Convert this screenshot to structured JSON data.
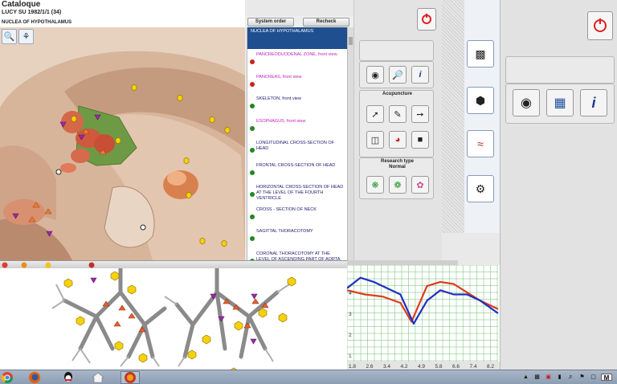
{
  "header": {
    "title": "Cataloque",
    "patient": "LUCY SU   1982/1/1 (34)",
    "section": "NUCLEA OF HYPOTHALAMUS"
  },
  "tabs": {
    "system_order": "System order",
    "recheck": "Recheck"
  },
  "list": {
    "selected": "NUCLEA OF HYPOTHALAMUS",
    "items": [
      {
        "label": "PANCREODUODENAL ZONE, front view",
        "color": "#c020c0",
        "dot": "#cc2222"
      },
      {
        "label": "PANCREAS, front view",
        "color": "#c020c0",
        "dot": "#cc2222"
      },
      {
        "label": "SKELETON, front view",
        "color": "#1a1a6e",
        "dot": "#228822"
      },
      {
        "label": "ESOPHAGUS, front view",
        "color": "#c020c0",
        "dot": "#228822"
      },
      {
        "label": "LONGITUDINAL CROSS-SECTION OF HEAD",
        "color": "#1a1a6e",
        "dot": "#228822"
      },
      {
        "label": "FRONTAL CROSS-SECTION OF HEAD",
        "color": "#1a1a6e",
        "dot": "#228822"
      },
      {
        "label": "HORIZONTAL CROSS-SECTION OF HEAD AT THE LEVEL OF THE FOURTH VENTRICLE",
        "color": "#1a1a6e",
        "dot": "#228822"
      },
      {
        "label": "CROSS - SECTION  OF   NECK",
        "color": "#1a1a6e",
        "dot": "#228822"
      },
      {
        "label": "SAGITTAL THORACOTOMY",
        "color": "#1a1a6e",
        "dot": "#228822"
      },
      {
        "label": "CORONAL THORACOTOMY AT THE LEVEL OF ASCENDING PART OF AORTA, FRONT VIEW",
        "color": "#1a1a6e",
        "dot": "#228822"
      }
    ]
  },
  "panel": {
    "acupuncture_label": "Acupuncture",
    "research_label": "Research type",
    "research_value": "Normal"
  },
  "chart_data": {
    "type": "line",
    "x_ticks": [
      "1.8",
      "2.6",
      "3.4",
      "4.2",
      "4.9",
      "5.8",
      "6.6",
      "7.4",
      "8.2"
    ],
    "y_ticks": [
      "4",
      "3",
      "2",
      "1"
    ],
    "series": [
      {
        "color": "#e03a1e",
        "x": [
          1.6,
          2.4,
          3.2,
          4.0,
          4.5,
          5.2,
          5.8,
          6.4,
          7.0,
          7.6,
          8.4
        ],
        "y": [
          4.1,
          3.9,
          3.8,
          3.5,
          2.6,
          4.3,
          4.5,
          4.4,
          4.0,
          3.6,
          3.2
        ]
      },
      {
        "color": "#2030c0",
        "x": [
          1.6,
          2.2,
          2.8,
          3.4,
          4.0,
          4.6,
          5.2,
          5.8,
          6.4,
          7.0,
          7.6,
          8.4
        ],
        "y": [
          4.2,
          4.7,
          4.5,
          4.2,
          3.9,
          2.5,
          3.6,
          4.1,
          3.9,
          3.9,
          3.6,
          3.0
        ]
      }
    ],
    "x_range": [
      1.6,
      8.4
    ],
    "y_range": [
      0.7,
      5.3
    ],
    "grid": true
  },
  "colors": {
    "accent": "#1f4f8f",
    "power": "#e02020"
  }
}
